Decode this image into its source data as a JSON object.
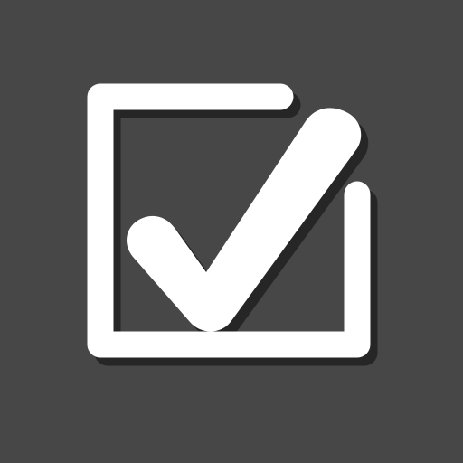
{
  "icon": {
    "name": "checkbox-checked-icon",
    "state": "checked",
    "colors": {
      "background": "#474747",
      "foreground": "#ffffff",
      "shadow": "#262626"
    }
  }
}
